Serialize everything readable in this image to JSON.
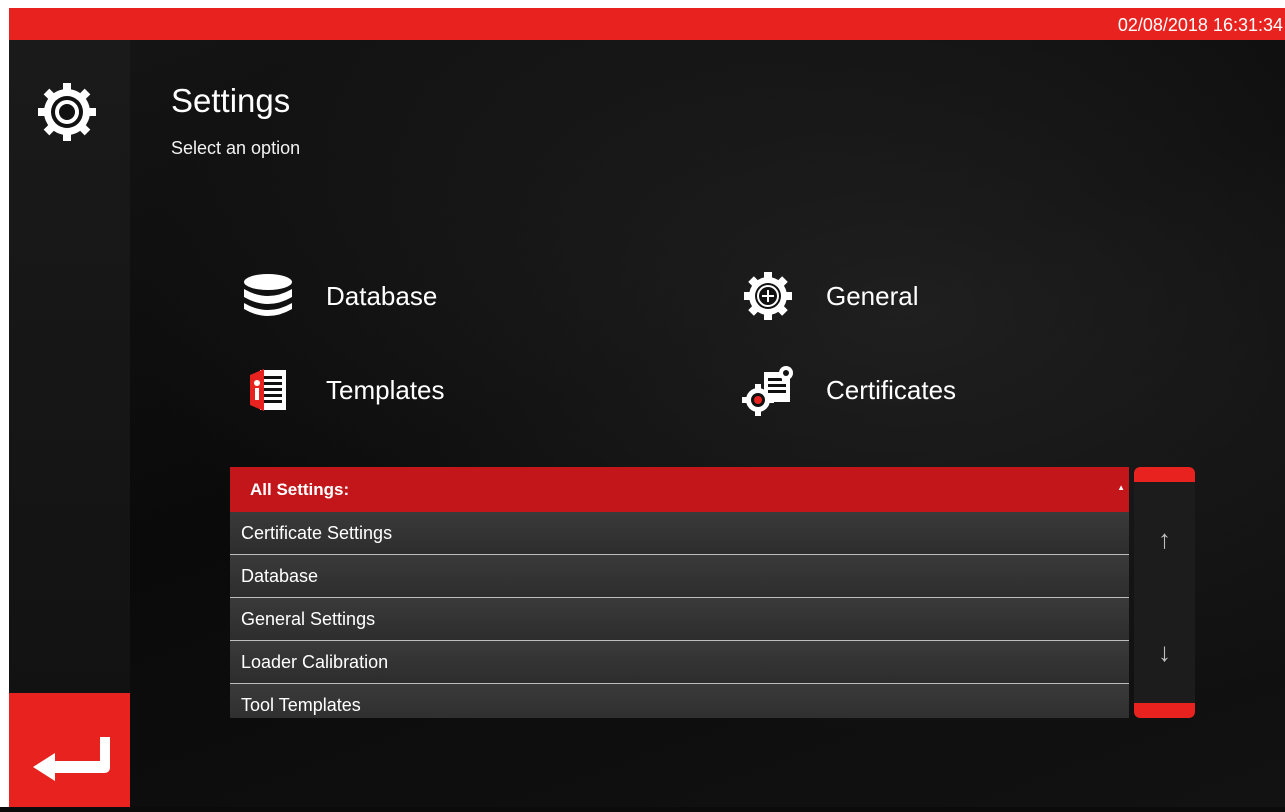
{
  "status_bar": {
    "datetime": "02/08/2018 16:31:34"
  },
  "header": {
    "title": "Settings",
    "subtitle": "Select an option",
    "icon": "gear-icon"
  },
  "options": [
    {
      "label": "Database",
      "icon": "database-icon"
    },
    {
      "label": "Templates",
      "icon": "templates-icon"
    },
    {
      "label": "General",
      "icon": "gear-plus-icon"
    },
    {
      "label": "Certificates",
      "icon": "certificate-gears-icon"
    }
  ],
  "settings_list": {
    "header": "All Settings:",
    "items": [
      "Certificate Settings",
      "Database",
      "General Settings",
      "Loader Calibration",
      "Tool Templates"
    ]
  },
  "scroll": {
    "up_glyph": "↑",
    "down_glyph": "↓"
  },
  "back": {
    "icon": "back-arrow-icon"
  },
  "colors": {
    "accent": "#e8231f",
    "list_header": "#c3161b",
    "background": "#0b0b0b"
  }
}
